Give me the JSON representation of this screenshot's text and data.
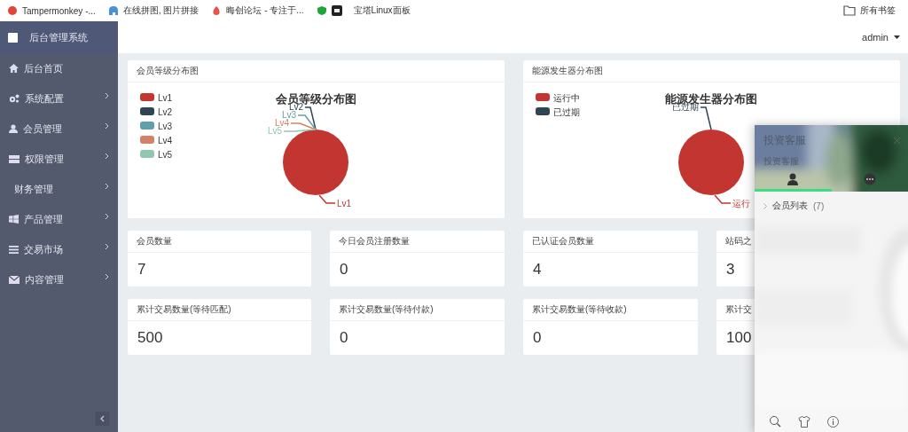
{
  "bookmarks": [
    {
      "label": "Tampermonkey -..."
    },
    {
      "label": "在线拼图, 图片拼接"
    },
    {
      "label": "晦创论坛 - 专注于..."
    },
    {
      "label": "宝塔Linux面板"
    }
  ],
  "all_bookmarks": "所有书签",
  "sidebar": {
    "title": "后台管理系统",
    "items": [
      {
        "label": "后台首页",
        "expandable": false
      },
      {
        "label": "系统配置",
        "expandable": true
      },
      {
        "label": "会员管理",
        "expandable": true
      },
      {
        "label": "权限管理",
        "expandable": true
      },
      {
        "label": "财务管理",
        "expandable": true
      },
      {
        "label": "产品管理",
        "expandable": true
      },
      {
        "label": "交易市场",
        "expandable": true
      },
      {
        "label": "内容管理",
        "expandable": true
      }
    ]
  },
  "header": {
    "user": "admin"
  },
  "charts": [
    {
      "title": "会员等级分布图",
      "chart_title": "会员等级分布图",
      "legend": [
        {
          "name": "Lv1",
          "color": "#c23531"
        },
        {
          "name": "Lv2",
          "color": "#2f4554"
        },
        {
          "name": "Lv3",
          "color": "#61a0a8"
        },
        {
          "name": "Lv4",
          "color": "#d48265"
        },
        {
          "name": "Lv5",
          "color": "#91c7ae"
        }
      ],
      "top_labels": [
        {
          "name": "Lv2",
          "color": "#2f4554"
        },
        {
          "name": "Lv3",
          "color": "#61a0a8"
        },
        {
          "name": "Lv4",
          "color": "#d48265"
        },
        {
          "name": "Lv5",
          "color": "#91c7ae"
        }
      ],
      "bottom_labels": [
        {
          "name": "Lv1",
          "color": "#c23531"
        }
      ]
    },
    {
      "title": "能源发生器分布图",
      "chart_title": "能源发生器分布图",
      "legend": [
        {
          "name": "运行中",
          "color": "#c23531"
        },
        {
          "name": "已过期",
          "color": "#2f4554"
        }
      ],
      "top_labels": [
        {
          "name": "已过期",
          "color": "#2f4554"
        }
      ],
      "bottom_labels": [
        {
          "name": "运行",
          "color": "#c23531"
        }
      ]
    }
  ],
  "stats": [
    [
      {
        "label": "会员数量",
        "value": "7"
      },
      {
        "label": "今日会员注册数量",
        "value": "0"
      },
      {
        "label": "已认证会员数量",
        "value": "4"
      },
      {
        "label": "站码之",
        "value": "3"
      }
    ],
    [
      {
        "label": "累计交易数量(等待匹配)",
        "value": "500"
      },
      {
        "label": "累计交易数量(等待付款)",
        "value": "0"
      },
      {
        "label": "累计交易数量(等待收款)",
        "value": "0"
      },
      {
        "label": "累计交",
        "value": "100"
      }
    ]
  ],
  "chat_panel": {
    "title": "投资客服",
    "subtitle": "投资客服",
    "tabs": [
      {
        "selected": true
      },
      {
        "selected": false
      }
    ],
    "group": {
      "label": "会员列表",
      "count": "(7)"
    }
  }
}
